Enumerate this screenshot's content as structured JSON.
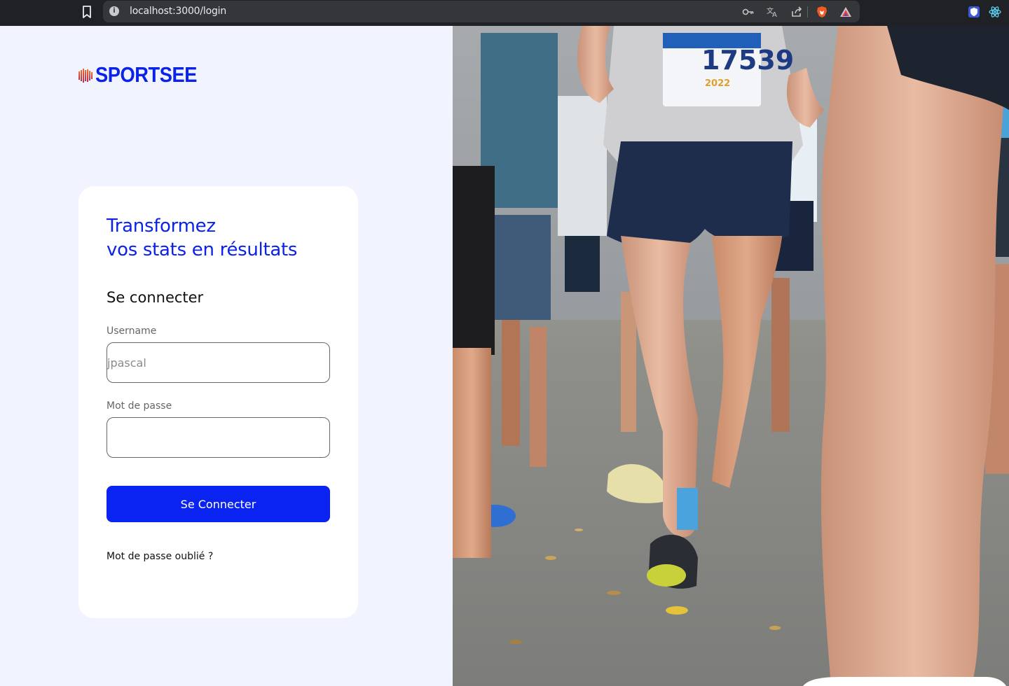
{
  "browser": {
    "url": "localhost:3000/login",
    "icons": [
      "bookmark-icon",
      "info-icon",
      "key-icon",
      "translate-icon",
      "share-icon",
      "brave-shield-icon",
      "brave-rewards-icon",
      "extension-shield-icon",
      "react-devtools-icon"
    ]
  },
  "brand": {
    "name": "SPORTSEE",
    "color": "#0b23e8",
    "accent_gradient": [
      "#f2a23a",
      "#e03a2f",
      "#7a2b8f"
    ]
  },
  "login": {
    "headline_line1": "Transformez",
    "headline_line2": "vos stats en résultats",
    "subtitle": "Se connecter",
    "username_label": "Username",
    "username_placeholder": "jpascal",
    "password_label": "Mot de passe",
    "password_value": "",
    "submit_label": "Se Connecter",
    "forgot_label": "Mot de passe oublié ?"
  },
  "hero": {
    "subject": "marathon runners on a city street",
    "bib_number": "17539",
    "bib_year": "2022"
  },
  "colors": {
    "page_bg": "#f1f3ff",
    "card_bg": "#ffffff",
    "button_bg": "#0b23f1",
    "button_text": "#ffffff"
  }
}
